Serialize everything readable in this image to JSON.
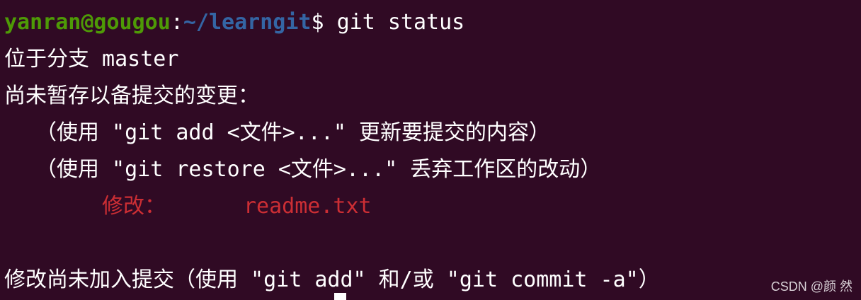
{
  "prompt": {
    "user_host": "yanran@gougou",
    "separator": ":",
    "path": "~/learngit",
    "symbol": "$",
    "command": " git status"
  },
  "output": {
    "branch_line": "位于分支 master",
    "unstaged_header": "尚未暂存以备提交的变更：",
    "hint_add": "（使用 \"git add <文件>...\" 更新要提交的内容）",
    "hint_restore": "（使用 \"git restore <文件>...\" 丢弃工作区的改动）",
    "modified_label": "修改：",
    "modified_file": "readme.txt",
    "summary": "修改尚未加入提交（使用 \"git add\" 和/或 \"git commit -a\"）"
  },
  "watermark": "CSDN @颜 然",
  "colors": {
    "background": "#300a24",
    "text": "#ffffff",
    "user_host": "#4e9a06",
    "path": "#3465a4",
    "modified": "#cc2e34"
  }
}
